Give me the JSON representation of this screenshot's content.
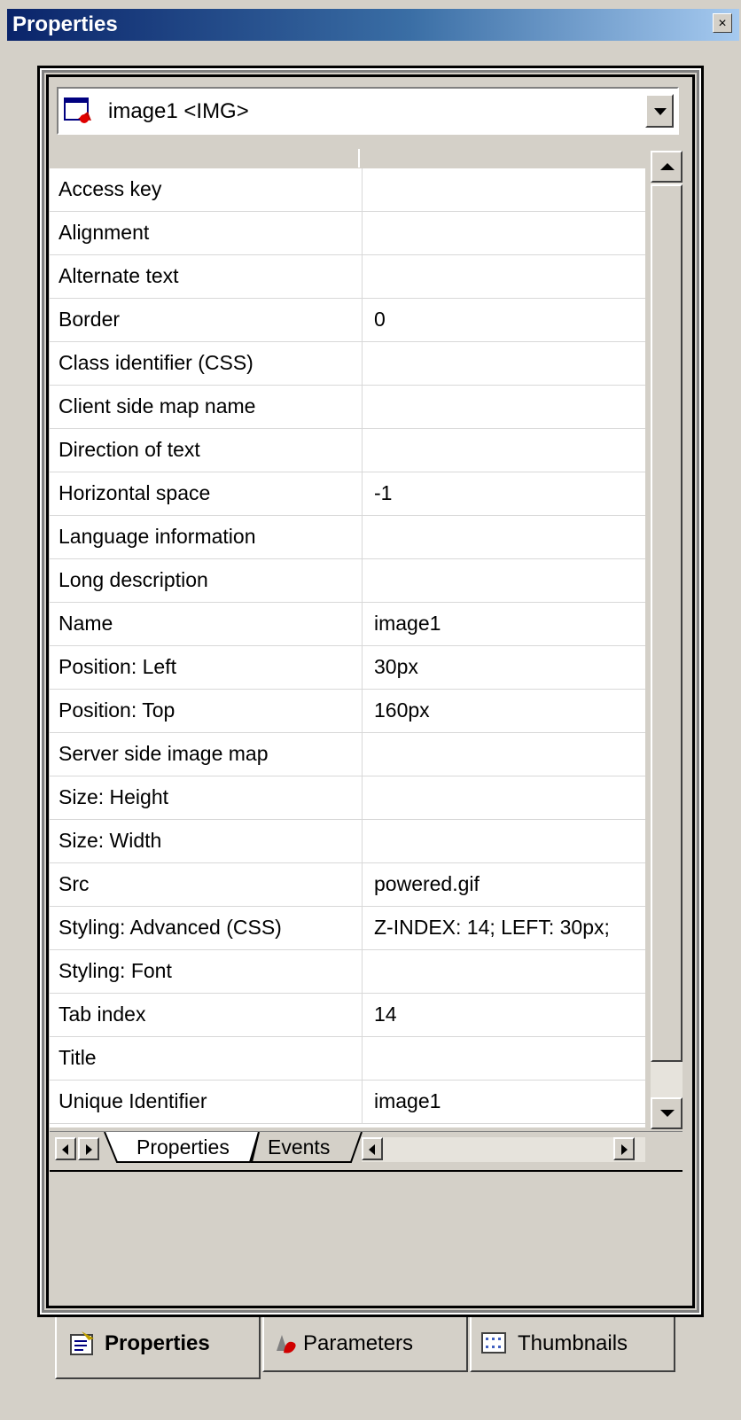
{
  "window": {
    "title": "Properties",
    "close_glyph": "×"
  },
  "selector": {
    "icon": "image-element-icon",
    "label": "image1 <IMG>"
  },
  "properties": [
    {
      "name": "Access key",
      "value": ""
    },
    {
      "name": "Alignment",
      "value": ""
    },
    {
      "name": "Alternate text",
      "value": ""
    },
    {
      "name": "Border",
      "value": "0"
    },
    {
      "name": "Class identifier (CSS)",
      "value": ""
    },
    {
      "name": "Client side map name",
      "value": ""
    },
    {
      "name": "Direction of text",
      "value": ""
    },
    {
      "name": "Horizontal space",
      "value": "-1"
    },
    {
      "name": "Language information",
      "value": ""
    },
    {
      "name": "Long description",
      "value": ""
    },
    {
      "name": "Name",
      "value": "image1"
    },
    {
      "name": "Position: Left",
      "value": "30px"
    },
    {
      "name": "Position: Top",
      "value": "160px"
    },
    {
      "name": "Server side image map",
      "value": ""
    },
    {
      "name": "Size: Height",
      "value": ""
    },
    {
      "name": "Size: Width",
      "value": ""
    },
    {
      "name": "Src",
      "value": "powered.gif"
    },
    {
      "name": "Styling: Advanced (CSS)",
      "value": "Z-INDEX: 14; LEFT: 30px;"
    },
    {
      "name": "Styling: Font",
      "value": ""
    },
    {
      "name": "Tab index",
      "value": "14"
    },
    {
      "name": "Title",
      "value": ""
    },
    {
      "name": "Unique Identifier",
      "value": "image1"
    }
  ],
  "grid_tabs": {
    "properties": "Properties",
    "events": "Events"
  },
  "bottom_tabs": [
    {
      "label": "Properties",
      "icon": "properties-icon",
      "active": true
    },
    {
      "label": "Parameters",
      "icon": "parameters-icon",
      "active": false
    },
    {
      "label": "Thumbnails",
      "icon": "thumbnails-icon",
      "active": false
    }
  ],
  "colors": {
    "title_start": "#0a246a",
    "title_end": "#a6caf0",
    "face": "#d4d0c8"
  }
}
